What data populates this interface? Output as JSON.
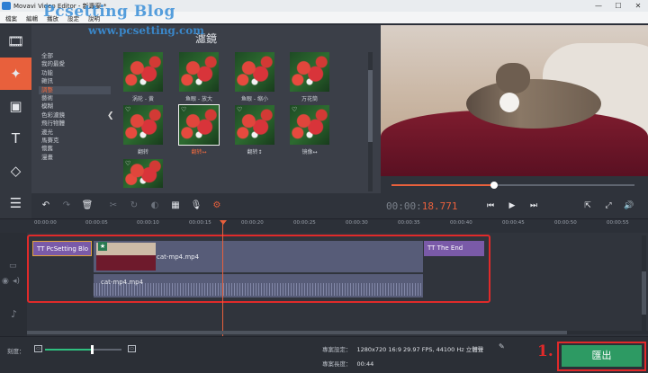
{
  "window": {
    "title": "Movavi Video Editor - 新專案 *",
    "min": "—",
    "max": "☐",
    "close": "✕"
  },
  "menu": [
    "檔案",
    "編輯",
    "播放",
    "設定",
    "說明"
  ],
  "watermark": {
    "line1": "Pcsetting Blog",
    "line2": "www.pcsetting.com"
  },
  "tools": [
    {
      "icon": "film-icon",
      "glyph": "🎞"
    },
    {
      "icon": "magic-wand-icon",
      "glyph": "✦"
    },
    {
      "icon": "transition-icon",
      "glyph": "▣"
    },
    {
      "icon": "text-icon",
      "glyph": "T"
    },
    {
      "icon": "shapes-icon",
      "glyph": "◇"
    },
    {
      "icon": "list-icon",
      "glyph": "☰"
    }
  ],
  "filters": {
    "title": "濾鏡",
    "categories": [
      "全部",
      "我的最愛",
      "功能",
      "雜訊",
      "調整",
      "藝術",
      "模糊",
      "色彩濾鏡",
      "飛行物體",
      "邊光",
      "馬賽克",
      "懷舊",
      "漫畫"
    ],
    "selected_category": "調整",
    "items": [
      {
        "label": "涡轮 - 黄",
        "selected": false,
        "fav": false
      },
      {
        "label": "鱼眼 - 放大",
        "selected": false,
        "fav": false
      },
      {
        "label": "鱼眼 - 缩小",
        "selected": false,
        "fav": false
      },
      {
        "label": "万花筒",
        "selected": false,
        "fav": false
      },
      {
        "label": "翻转",
        "selected": false,
        "fav": true
      },
      {
        "label": "翻转↔",
        "selected": true,
        "fav": true
      },
      {
        "label": "翻转↕",
        "selected": false,
        "fav": true
      },
      {
        "label": "镜像↔",
        "selected": false,
        "fav": true
      },
      {
        "label": "",
        "selected": false,
        "fav": true
      }
    ]
  },
  "player": {
    "time_dim": "00:00:",
    "time_hl": "18.771",
    "progress": 0.42,
    "buttons": [
      "⏮",
      "▶",
      "⏭",
      "⇱",
      "⤢",
      "🔊"
    ]
  },
  "edit_toolbar": [
    {
      "name": "undo-icon",
      "glyph": "↶",
      "state": "on"
    },
    {
      "name": "redo-icon",
      "glyph": "↷",
      "state": "dim"
    },
    {
      "name": "delete-icon",
      "glyph": "🗑",
      "state": "on"
    },
    {
      "name": "cut-icon",
      "glyph": "✂",
      "state": "dim"
    },
    {
      "name": "rotate-icon",
      "glyph": "↻",
      "state": "dim"
    },
    {
      "name": "color-icon",
      "glyph": "◐",
      "state": "dim"
    },
    {
      "name": "image-icon",
      "glyph": "▦",
      "state": "on"
    },
    {
      "name": "mic-icon",
      "glyph": "🎙",
      "state": "on"
    },
    {
      "name": "settings-icon",
      "glyph": "⚙",
      "state": "act"
    }
  ],
  "ruler": [
    "00:00:00",
    "00:00:05",
    "00:00:10",
    "00:00:15",
    "00:00:20",
    "00:00:25",
    "00:00:30",
    "00:00:35",
    "00:00:40",
    "00:00:45",
    "00:00:50",
    "00:00:55"
  ],
  "timeline": {
    "title_clip_1": "PcSetting Blo",
    "title_clip_2": "The End",
    "video_clip": "cat-mp4.mp4",
    "audio_clip": "cat-mp4.mp4",
    "title_glyph": "TT"
  },
  "status": {
    "zoom_label": "刻度：",
    "project_settings_label": "專案設定：",
    "project_settings_value": "1280x720 16:9 29.97 FPS, 44100 Hz 立體聲",
    "project_length_label": "專案長度：",
    "project_length_value": "00:44",
    "export_label": "匯出",
    "step_label": "1."
  }
}
